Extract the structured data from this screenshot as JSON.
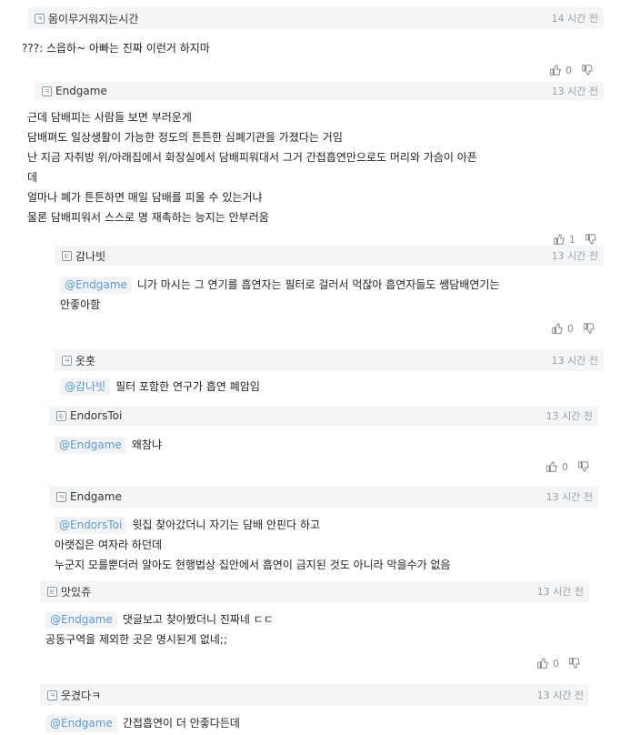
{
  "comments": [
    {
      "level": "ㅋ",
      "nick": "몸이무거워지는시간",
      "time": "14 시간 전",
      "lines": [
        "???: 스읍하~ 아빠는 진짜 이런거 하지마"
      ],
      "votes": "0"
    },
    {
      "level": "ㅋ",
      "nick": "Endgame",
      "time": "13 시간 전",
      "lines": [
        "근데 담배피는 사람들 보면 부러운게",
        "담배펴도 일상생활이 가능한 정도의 튼튼한 심폐기관을 가졌다는 거임",
        "난 지금 자취방 위/아래집에서 화장실에서 담배피워대서 그거 간접흡연만으로도 머리와 가슴이 아픈",
        "데",
        "얼마나 폐가 튼튼하면 매일 담배를 피울 수 있는거냐",
        "물론 담배피워서 스스로 명 재촉하는 능지는 안부러움"
      ],
      "votes": "1"
    },
    {
      "level": "ㅌ",
      "nick": "감나빗",
      "time": "13 시간 전",
      "mention": "@Endgame",
      "lines": [
        "니가 마시는 그 연기를 흡연자는 필터로 걸러서 먹잖아 흡연자들도 쌩담배연기는",
        "안좋아함"
      ],
      "votes": "0"
    },
    {
      "level": "ㅋ",
      "nick": "옷홋",
      "time": "13 시간 전",
      "mention": "@감나빗",
      "lines": [
        "필터 포함한 연구가 흡연 폐암임"
      ]
    },
    {
      "level": "ㅌ",
      "nick": "EndorsToi",
      "time": "13 시간 전",
      "mention": "@Endgame",
      "lines": [
        "왜참냐"
      ],
      "votes": "0"
    },
    {
      "level": "ㅋ",
      "nick": "Endgame",
      "time": "13 시간 전",
      "mention": "@EndorsToi",
      "lines": [
        "윗집 찾아갔더니 자기는 담배 안핀다 하고",
        "아랫집은 여자라 하던데",
        "누군지 모를뿐더러 알아도 현행법상 집안에서 흡연이 금지된 것도 아니라 막을수가 없음"
      ]
    },
    {
      "level": "ㅌ",
      "nick": "맛있쥬",
      "time": "13 시간 전",
      "mention": "@Endgame",
      "lines": [
        "댓글보고 찾아봤더니 진짜네 ㄷㄷ",
        "공동구역을 제외한 곳은 명시된게 없네;;"
      ],
      "votes": "0"
    },
    {
      "level": "ㅋ",
      "nick": "웃겼다ㅋ",
      "time": "13 시간 전",
      "mention": "@Endgame",
      "lines": [
        "간접흡연이 더 안좋다든데"
      ]
    }
  ],
  "colors": {
    "mention": "#5b9bd5",
    "header_bg": "#f4f5f6",
    "time": "#9aa0a6"
  },
  "icons": {
    "upvote": "thumbs-up-icon",
    "downvote": "thumbs-down-icon",
    "level": "level-badge-icon"
  }
}
